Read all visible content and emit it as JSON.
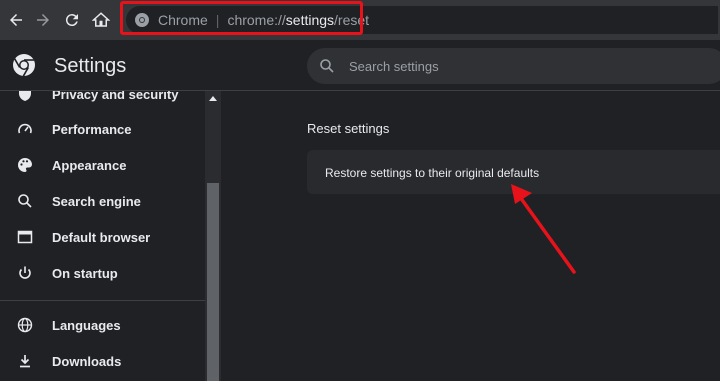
{
  "toolbar": {
    "back": "back",
    "forward": "forward",
    "reload": "reload",
    "home": "home"
  },
  "omnibox": {
    "site_name": "Chrome",
    "url_scheme": "chrome://",
    "url_path_highlight": "settings",
    "url_suffix": "/reset",
    "icon": "chrome-icon"
  },
  "header": {
    "title": "Settings",
    "search_placeholder": "Search settings"
  },
  "sidebar": {
    "items": [
      {
        "label": "Privacy and security",
        "icon": "shield-icon"
      },
      {
        "label": "Performance",
        "icon": "speedometer-icon"
      },
      {
        "label": "Appearance",
        "icon": "palette-icon"
      },
      {
        "label": "Search engine",
        "icon": "search-icon"
      },
      {
        "label": "Default browser",
        "icon": "browser-window-icon"
      },
      {
        "label": "On startup",
        "icon": "power-icon"
      },
      {
        "label": "Languages",
        "icon": "globe-icon"
      },
      {
        "label": "Downloads",
        "icon": "download-icon"
      }
    ]
  },
  "main": {
    "section_title": "Reset settings",
    "restore_label": "Restore settings to their original defaults"
  },
  "colors": {
    "annotation": "#e8121b",
    "background": "#202124",
    "card": "#292a2d"
  }
}
